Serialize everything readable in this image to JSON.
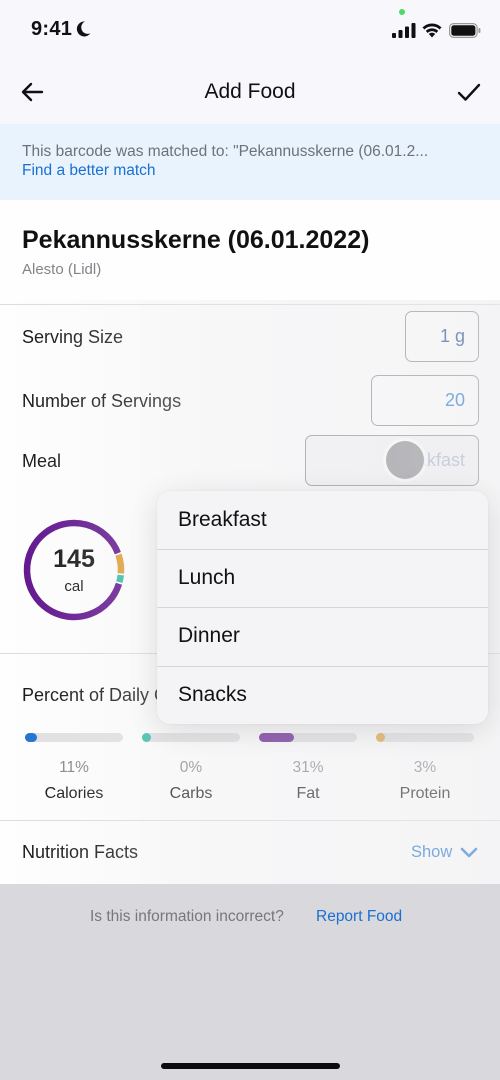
{
  "status_bar": {
    "time": "9:41",
    "icons": [
      "moon-icon",
      "signal-icon",
      "wifi-icon",
      "battery-icon"
    ]
  },
  "nav": {
    "title": "Add Food",
    "back_icon": "arrow-left-icon",
    "confirm_icon": "checkmark-icon"
  },
  "banner": {
    "text": "This barcode was matched to: \"Pekannusskerne (06.01.2...",
    "link": "Find a better match"
  },
  "food": {
    "name": "Pekannusskerne (06.01.2022)",
    "brand": "Alesto (Lidl)"
  },
  "form": {
    "serving_size": {
      "label": "Serving Size",
      "value": "1 g"
    },
    "servings": {
      "label": "Number of Servings",
      "value": "20"
    },
    "meal": {
      "label": "Meal",
      "value": "Breakfast"
    }
  },
  "calories_ring": {
    "value": "145",
    "unit": "cal",
    "segments": [
      {
        "name": "fat",
        "fraction": 0.9,
        "color": "#5e0f8b"
      },
      {
        "name": "protein",
        "fraction": 0.07,
        "color": "#e09b2d"
      },
      {
        "name": "carbs",
        "fraction": 0.03,
        "color": "#2bbba0"
      }
    ]
  },
  "daily_goals": {
    "label": "Percent of Daily Goals",
    "items": [
      {
        "name": "Calories",
        "percent_label": "11%",
        "percent": 11,
        "color": "#1a6fd1"
      },
      {
        "name": "Carbs",
        "percent_label": "0%",
        "percent": 0,
        "color": "#2bbba0"
      },
      {
        "name": "Fat",
        "percent_label": "31%",
        "percent": 31,
        "color": "#5e0f8b"
      },
      {
        "name": "Protein",
        "percent_label": "3%",
        "percent": 3,
        "color": "#e09b2d"
      }
    ]
  },
  "nutrition_facts": {
    "label": "Nutrition Facts",
    "toggle": "Show"
  },
  "report": {
    "question": "Is this information incorrect?",
    "link": "Report Food"
  },
  "meal_menu": {
    "options": [
      "Breakfast",
      "Lunch",
      "Dinner",
      "Snacks"
    ]
  }
}
